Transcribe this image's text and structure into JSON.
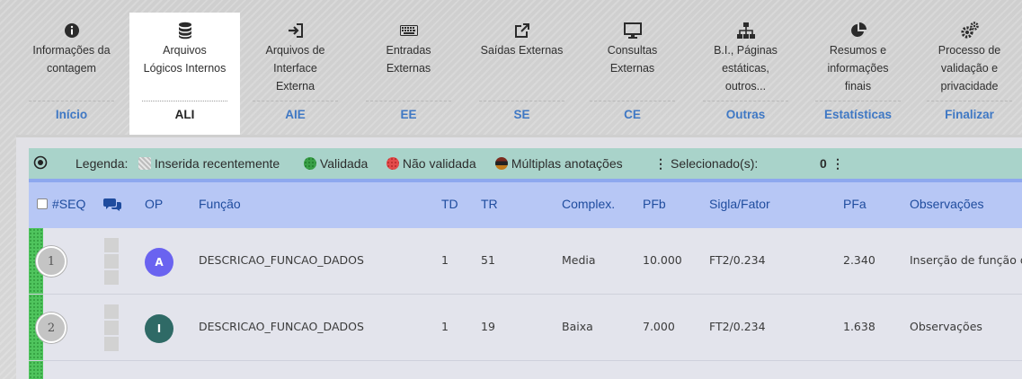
{
  "nav": {
    "items": [
      {
        "icon": "info-icon",
        "label_lines": [
          "Informações da",
          "contagem"
        ],
        "short": "Início",
        "active": false
      },
      {
        "icon": "database-icon",
        "label_lines": [
          "Arquivos",
          "Lógicos Internos"
        ],
        "short": "ALI",
        "active": true
      },
      {
        "icon": "sign-in-icon",
        "label_lines": [
          "Arquivos de",
          "Interface",
          "Externa"
        ],
        "short": "AIE",
        "active": false
      },
      {
        "icon": "keyboard-icon",
        "label_lines": [
          "Entradas",
          "Externas"
        ],
        "short": "EE",
        "active": false
      },
      {
        "icon": "external-link-icon",
        "label_lines": [
          "Saídas Externas"
        ],
        "short": "SE",
        "active": false
      },
      {
        "icon": "monitor-icon",
        "label_lines": [
          "Consultas",
          "Externas"
        ],
        "short": "CE",
        "active": false
      },
      {
        "icon": "sitemap-icon",
        "label_lines": [
          "B.I., Páginas",
          "estáticas,",
          "outros..."
        ],
        "short": "Outras",
        "active": false
      },
      {
        "icon": "pie-chart-icon",
        "label_lines": [
          "Resumos e",
          "informações",
          "finais"
        ],
        "short": "Estatísticas",
        "active": false
      },
      {
        "icon": "cogs-icon",
        "label_lines": [
          "Processo de",
          "validação e",
          "privacidade"
        ],
        "short": "Finalizar",
        "active": false
      }
    ]
  },
  "legend": {
    "label": "Legenda:",
    "recent": "Inserida recentemente",
    "validated": "Validada",
    "not_validated": "Não validada",
    "multiple": "Múltiplas anotações",
    "selected_label": "Selecionado(s):",
    "selected_count": "0",
    "colors": {
      "validated": "#3aa048",
      "not_validated": "#e34b4b"
    }
  },
  "table": {
    "headers": {
      "seq": "#SEQ",
      "op": "OP",
      "funcao": "Função",
      "td": "TD",
      "tr": "TR",
      "complex": "Complex.",
      "pfb": "PFb",
      "sigla": "Sigla/Fator",
      "pfa": "PFa",
      "obs": "Observações"
    },
    "rows": [
      {
        "seq": "1",
        "op": "A",
        "op_color": "#6a63f0",
        "funcao": "DESCRICAO_FUNCAO_DADOS",
        "td": "1",
        "tr": "51",
        "complex": "Media",
        "pfb": "10.000",
        "sigla": "FT2/0.234",
        "pfa": "2.340",
        "obs": "Inserção de função d"
      },
      {
        "seq": "2",
        "op": "I",
        "op_color": "#2f6a66",
        "funcao": "DESCRICAO_FUNCAO_DADOS",
        "td": "1",
        "tr": "19",
        "complex": "Baixa",
        "pfb": "7.000",
        "sigla": "FT2/0.234",
        "pfa": "1.638",
        "obs": "Observações"
      }
    ]
  }
}
